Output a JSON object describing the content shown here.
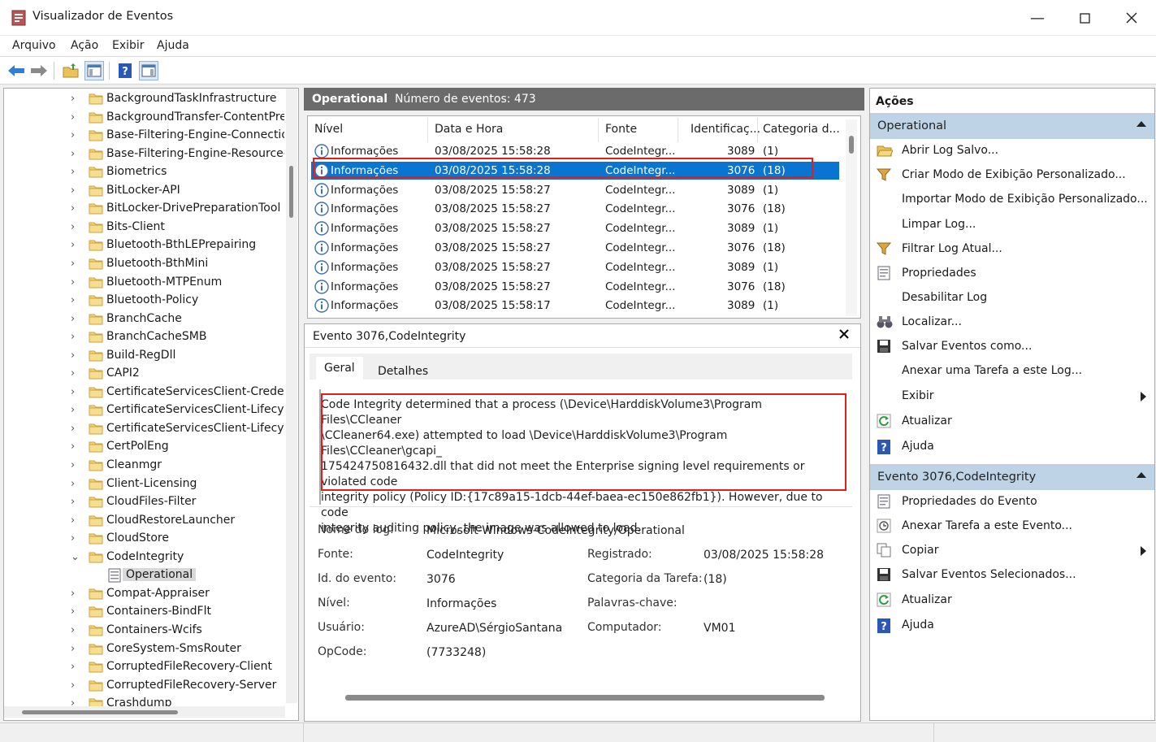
{
  "window": {
    "title": "Visualizador de Eventos"
  },
  "menu": [
    "Arquivo",
    "Ação",
    "Exibir",
    "Ajuda"
  ],
  "tree": {
    "items": [
      {
        "label": "BackgroundTaskInfrastructure",
        "expanded": false
      },
      {
        "label": "BackgroundTransfer-ContentPref",
        "expanded": false
      },
      {
        "label": "Base-Filtering-Engine-Connectio",
        "expanded": false
      },
      {
        "label": "Base-Filtering-Engine-Resource-I",
        "expanded": false
      },
      {
        "label": "Biometrics",
        "expanded": false
      },
      {
        "label": "BitLocker-API",
        "expanded": false
      },
      {
        "label": "BitLocker-DrivePreparationTool",
        "expanded": false
      },
      {
        "label": "Bits-Client",
        "expanded": false
      },
      {
        "label": "Bluetooth-BthLEPrepairing",
        "expanded": false
      },
      {
        "label": "Bluetooth-BthMini",
        "expanded": false
      },
      {
        "label": "Bluetooth-MTPEnum",
        "expanded": false
      },
      {
        "label": "Bluetooth-Policy",
        "expanded": false
      },
      {
        "label": "BranchCache",
        "expanded": false
      },
      {
        "label": "BranchCacheSMB",
        "expanded": false
      },
      {
        "label": "Build-RegDll",
        "expanded": false
      },
      {
        "label": "CAPI2",
        "expanded": false
      },
      {
        "label": "CertificateServicesClient-Credenti",
        "expanded": false
      },
      {
        "label": "CertificateServicesClient-Lifecycle",
        "expanded": false
      },
      {
        "label": "CertificateServicesClient-Lifecycle",
        "expanded": false
      },
      {
        "label": "CertPolEng",
        "expanded": false
      },
      {
        "label": "Cleanmgr",
        "expanded": false
      },
      {
        "label": "Client-Licensing",
        "expanded": false
      },
      {
        "label": "CloudFiles-Filter",
        "expanded": false
      },
      {
        "label": "CloudRestoreLauncher",
        "expanded": false
      },
      {
        "label": "CloudStore",
        "expanded": false
      },
      {
        "label": "CodeIntegrity",
        "expanded": true
      },
      {
        "label": "Operational",
        "child": true
      },
      {
        "label": "Compat-Appraiser",
        "expanded": false
      },
      {
        "label": "Containers-BindFlt",
        "expanded": false
      },
      {
        "label": "Containers-Wcifs",
        "expanded": false
      },
      {
        "label": "CoreSystem-SmsRouter",
        "expanded": false
      },
      {
        "label": "CorruptedFileRecovery-Client",
        "expanded": false
      },
      {
        "label": "CorruptedFileRecovery-Server",
        "expanded": false
      },
      {
        "label": "Crashdump",
        "expanded": false
      }
    ]
  },
  "log_header": {
    "name": "Operational",
    "count_text": "Número de eventos: 473"
  },
  "events": {
    "columns": [
      "Nível",
      "Data e Hora",
      "Fonte",
      "Identificaç...",
      "Categoria d..."
    ],
    "rows": [
      {
        "level": "Informações",
        "datetime": "03/08/2025 15:58:28",
        "source": "CodeIntegr...",
        "id": "3089",
        "category": "(1)"
      },
      {
        "level": "Informações",
        "datetime": "03/08/2025 15:58:28",
        "source": "CodeIntegr...",
        "id": "3076",
        "category": "(18)",
        "selected": true
      },
      {
        "level": "Informações",
        "datetime": "03/08/2025 15:58:27",
        "source": "CodeIntegr...",
        "id": "3089",
        "category": "(1)"
      },
      {
        "level": "Informações",
        "datetime": "03/08/2025 15:58:27",
        "source": "CodeIntegr...",
        "id": "3076",
        "category": "(18)"
      },
      {
        "level": "Informações",
        "datetime": "03/08/2025 15:58:27",
        "source": "CodeIntegr...",
        "id": "3089",
        "category": "(1)"
      },
      {
        "level": "Informações",
        "datetime": "03/08/2025 15:58:27",
        "source": "CodeIntegr...",
        "id": "3076",
        "category": "(18)"
      },
      {
        "level": "Informações",
        "datetime": "03/08/2025 15:58:27",
        "source": "CodeIntegr...",
        "id": "3089",
        "category": "(1)"
      },
      {
        "level": "Informações",
        "datetime": "03/08/2025 15:58:27",
        "source": "CodeIntegr...",
        "id": "3076",
        "category": "(18)"
      },
      {
        "level": "Informações",
        "datetime": "03/08/2025 15:58:17",
        "source": "CodeIntegr...",
        "id": "3089",
        "category": "(1)"
      }
    ]
  },
  "detail": {
    "title": "Evento 3076,CodeIntegrity",
    "tabs": [
      "Geral",
      "Detalhes"
    ],
    "description_lines": [
      "Code Integrity determined that a process (\\Device\\HarddiskVolume3\\Program Files\\CCleaner",
      "\\CCleaner64.exe) attempted to load \\Device\\HarddiskVolume3\\Program Files\\CCleaner\\gcapi_",
      "175424750816432.dll that did not meet the Enterprise signing level requirements or violated code",
      "integrity policy (Policy ID:{17c89a15-1dcb-44ef-baea-ec150e862fb1}). However, due to code",
      "integrity auditing policy, the image was allowed to load."
    ],
    "fields": {
      "log_name_label": "Nome do log:",
      "log_name": "Microsoft-Windows-CodeIntegrity/Operational",
      "source_label": "Fonte:",
      "source": "CodeIntegrity",
      "logged_label": "Registrado:",
      "logged": "03/08/2025 15:58:28",
      "event_id_label": "Id. do evento:",
      "event_id": "3076",
      "task_label": "Categoria da Tarefa:",
      "task": "(18)",
      "level_label": "Nível:",
      "level": "Informações",
      "keywords_label": "Palavras-chave:",
      "user_label": "Usuário:",
      "user": "AzureAD\\SérgioSantana",
      "computer_label": "Computador:",
      "computer": "VM01",
      "opcode_label": "OpCode:",
      "opcode": "(7733248)"
    }
  },
  "actions": {
    "title": "Ações",
    "section1": {
      "title": "Operational",
      "items": [
        {
          "label": "Abrir Log Salvo...",
          "icon": "folder-open-icon"
        },
        {
          "label": "Criar Modo de Exibição Personalizado...",
          "icon": "filter-icon"
        },
        {
          "label": "Importar Modo de Exibição Personalizado...",
          "icon": ""
        },
        {
          "label": "Limpar Log...",
          "icon": ""
        },
        {
          "label": "Filtrar Log Atual...",
          "icon": "filter-icon"
        },
        {
          "label": "Propriedades",
          "icon": "properties-icon"
        },
        {
          "label": "Desabilitar Log",
          "icon": ""
        },
        {
          "label": "Localizar...",
          "icon": "binoculars-icon"
        },
        {
          "label": "Salvar Eventos como...",
          "icon": "save-icon"
        },
        {
          "label": "Anexar uma Tarefa a este Log...",
          "icon": ""
        },
        {
          "label": "Exibir",
          "icon": "",
          "submenu": true
        },
        {
          "label": "Atualizar",
          "icon": "refresh-icon"
        },
        {
          "label": "Ajuda",
          "icon": "help-icon"
        }
      ]
    },
    "section2": {
      "title": "Evento 3076,CodeIntegrity",
      "items": [
        {
          "label": "Propriedades do Evento",
          "icon": "properties-icon"
        },
        {
          "label": "Anexar Tarefa a este Evento...",
          "icon": "task-icon"
        },
        {
          "label": "Copiar",
          "icon": "copy-icon",
          "submenu": true
        },
        {
          "label": "Salvar Eventos Selecionados...",
          "icon": "save-icon"
        },
        {
          "label": "Atualizar",
          "icon": "refresh-icon"
        },
        {
          "label": "Ajuda",
          "icon": "help-icon"
        }
      ]
    }
  },
  "colors": {
    "selection": "#0a74d1",
    "highlight_box": "#e11d1d",
    "action_header": "#bfd3e6",
    "log_header": "#6b6b6b"
  }
}
